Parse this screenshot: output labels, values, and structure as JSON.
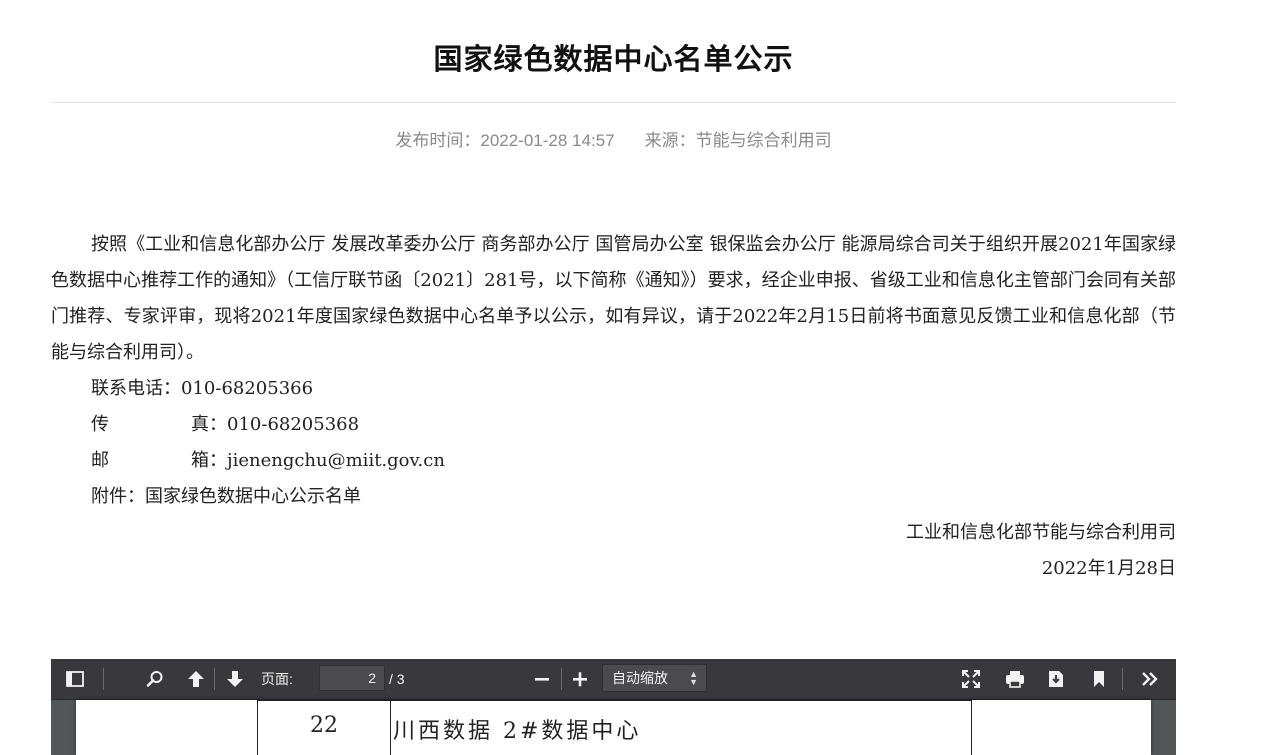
{
  "article": {
    "title": "国家绿色数据中心名单公示",
    "publish_time": "发布时间：2022-01-28 14:57",
    "source": "来源：节能与综合利用司",
    "paragraph": "按照《工业和信息化部办公厅 发展改革委办公厅 商务部办公厅 国管局办公室 银保监会办公厅 能源局综合司关于组织开展2021年国家绿色数据中心推荐工作的通知》（工信厅联节函〔2021〕281号，以下简称《通知》）要求，经企业申报、省级工业和信息化主管部门会同有关部门推荐、专家评审，现将2021年度国家绿色数据中心名单予以公示，如有异议，请于2022年2月15日前将书面意见反馈工业和信息化部（节能与综合利用司）。",
    "phone": "联系电话：010-68205366",
    "fax_label": "传",
    "fax_value": "真：010-68205368",
    "email_label": "邮",
    "email_value": "箱：jienengchu@miit.gov.cn",
    "attachment": "附件：国家绿色数据中心公示名单",
    "signature": "工业和信息化部节能与综合利用司",
    "date": "2022年1月28日"
  },
  "pdf_viewer": {
    "page_label": "页面:",
    "current_page": "2",
    "total_pages": "/ 3",
    "zoom": "自动缩放",
    "icons": {
      "sidebar": "sidebar-toggle-icon",
      "find": "search-icon",
      "prev": "arrow-up-icon",
      "next": "arrow-down-icon",
      "zoom_out": "minus-icon",
      "zoom_in": "plus-icon",
      "presentation": "fullscreen-icon",
      "print": "print-icon",
      "download": "download-icon",
      "bookmark": "bookmark-icon",
      "tools": "double-chevron-right-icon"
    },
    "table_row": {
      "number": "22",
      "name": "川西数据 2#数据中心"
    }
  }
}
